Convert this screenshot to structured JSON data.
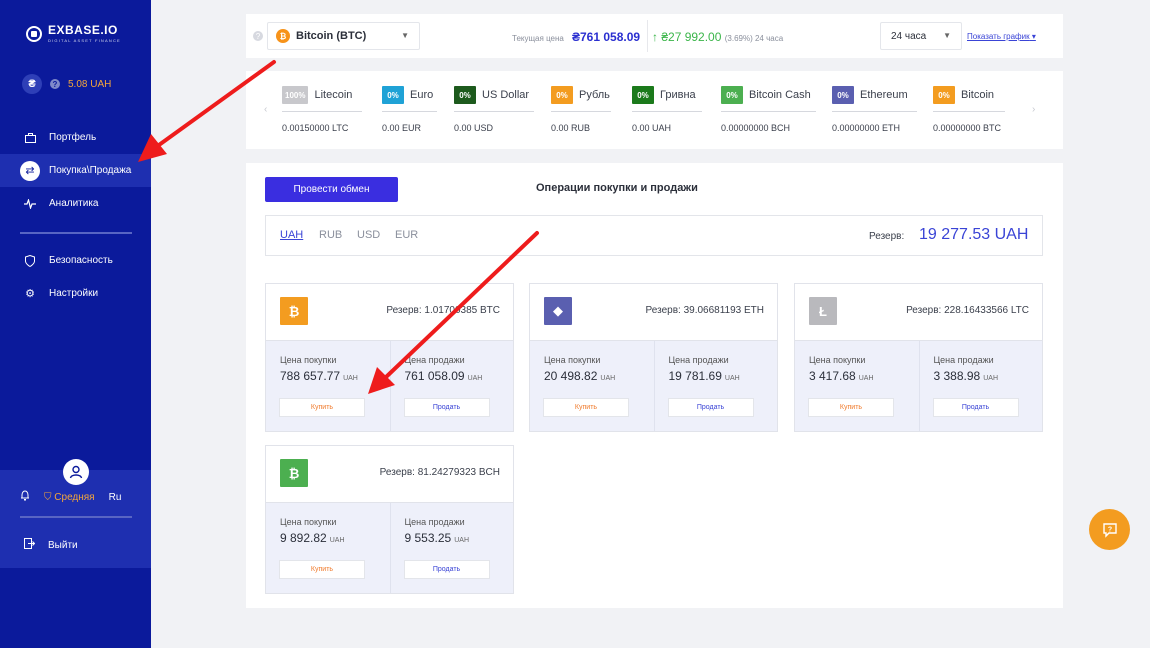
{
  "brand": {
    "name": "EXBASE.IO",
    "tagline": "DIGITAL ASSET FINANCE"
  },
  "balance": {
    "currency_symbol": "₴",
    "amount": "5.08 UAH"
  },
  "nav": [
    {
      "label": "Портфель",
      "icon": "briefcase-icon"
    },
    {
      "label": "Покупка\\Продажа",
      "icon": "exchange-icon",
      "active": true
    },
    {
      "label": "Аналитика",
      "icon": "analytics-icon"
    },
    {
      "label": "Безопасность",
      "icon": "shield-icon"
    },
    {
      "label": "Настройки",
      "icon": "gear-icon"
    }
  ],
  "user": {
    "level": "Средняя",
    "lang": "Ru",
    "logout": "Выйти"
  },
  "topbar": {
    "coin": "Bitcoin (BTC)",
    "coin_symbol": "₿",
    "price_label": "Текущая цена",
    "price": "₴761 058.09",
    "change": "₴27 992.00",
    "change_pct": "(3.69%) 24 часа",
    "period": "24 часа",
    "show_chart": "Показать график"
  },
  "ticker": [
    {
      "badge": "100%",
      "name": "Litecoin",
      "amount": "0.00150000 LTC",
      "color": "#c8c8cc"
    },
    {
      "badge": "0%",
      "name": "Euro",
      "amount": "0.00 EUR",
      "color": "#1fa2d6"
    },
    {
      "badge": "0%",
      "name": "US Dollar",
      "amount": "0.00 USD",
      "color": "#1d5a1d"
    },
    {
      "badge": "0%",
      "name": "Рубль",
      "amount": "0.00 RUB",
      "color": "#f39c20"
    },
    {
      "badge": "0%",
      "name": "Гривна",
      "amount": "0.00 UAH",
      "color": "#1b7a1b"
    },
    {
      "badge": "0%",
      "name": "Bitcoin Cash",
      "amount": "0.00000000 BCH",
      "color": "#4caf50"
    },
    {
      "badge": "0%",
      "name": "Ethereum",
      "amount": "0.00000000 ETH",
      "color": "#5a5fb0"
    },
    {
      "badge": "0%",
      "name": "Bitcoin",
      "amount": "0.00000000 BTC",
      "color": "#f39c20"
    }
  ],
  "main": {
    "exchange_button": "Провести обмен",
    "title": "Операции покупки и продажи",
    "tabs": [
      "UAH",
      "RUB",
      "USD",
      "EUR"
    ],
    "reserve_label": "Резерв:",
    "reserve_value": "19 277.53 UAH"
  },
  "cards": [
    {
      "symbol": "₿",
      "color": "#f39c20",
      "reserve": "Резерв: 1.01700385 BTC",
      "buy_label": "Цена покупки",
      "buy": "788 657.77",
      "sell_label": "Цена продажи",
      "sell": "761 058.09",
      "unit": "UAH",
      "buy_btn": "Купить",
      "sell_btn": "Продать"
    },
    {
      "symbol": "◆",
      "color": "#5a5fb0",
      "reserve": "Резерв: 39.06681193 ETH",
      "buy_label": "Цена покупки",
      "buy": "20 498.82",
      "sell_label": "Цена продажи",
      "sell": "19 781.69",
      "unit": "UAH",
      "buy_btn": "Купить",
      "sell_btn": "Продать"
    },
    {
      "symbol": "Ł",
      "color": "#b9b9bd",
      "reserve": "Резерв: 228.16433566 LTC",
      "buy_label": "Цена покупки",
      "buy": "3 417.68",
      "sell_label": "Цена продажи",
      "sell": "3 388.98",
      "unit": "UAH",
      "buy_btn": "Купить",
      "sell_btn": "Продать"
    },
    {
      "symbol": "₿",
      "color": "#4caf50",
      "reserve": "Резерв: 81.24279323 BCH",
      "buy_label": "Цена покупки",
      "buy": "9 892.82",
      "sell_label": "Цена продажи",
      "sell": "9 553.25",
      "unit": "UAH",
      "buy_btn": "Купить",
      "sell_btn": "Продать"
    }
  ]
}
